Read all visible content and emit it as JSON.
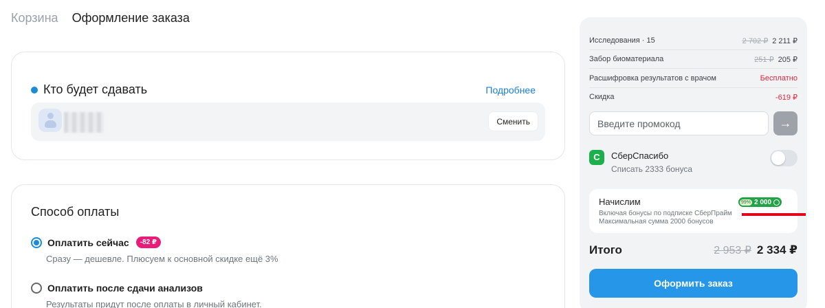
{
  "breadcrumb": {
    "prev": "Корзина",
    "current": "Оформление заказа"
  },
  "who": {
    "title": "Кто будет сдавать",
    "more_link": "Подробнее",
    "change_button": "Сменить"
  },
  "payment": {
    "title": "Способ оплаты",
    "options": [
      {
        "label": "Оплатить сейчас",
        "badge": "-82 ₽",
        "description": "Сразу — дешевле. Плюсуем к основной скидке ещё 3%",
        "selected": true
      },
      {
        "label": "Оплатить после сдачи анализов",
        "description": "Результаты придут после оплаты в личный кабинет.",
        "selected": false
      }
    ]
  },
  "summary": {
    "lines": [
      {
        "label": "Исследования · 15",
        "old": "2 702 ₽",
        "value": "2 211 ₽"
      },
      {
        "label": "Забор биоматериала",
        "old": "251 ₽",
        "value": "205 ₽"
      },
      {
        "label": "Расшифровка результатов с врачом",
        "value": "Бесплатно"
      },
      {
        "label": "Скидка",
        "value": "-619 ₽"
      }
    ],
    "promo_placeholder": "Введите промокод",
    "sber": {
      "logo": "С",
      "title": "СберСпасибо",
      "subtitle": "Списать 2333 бонуса",
      "enabled": false
    },
    "accrue": {
      "title": "Начислим",
      "line1": "Включая бонусы по подписке СберПрайм",
      "line2": "Максимальная сумма 2000 бонусов",
      "badge_percent": "99%",
      "badge_value": "2 000"
    },
    "total": {
      "label": "Итого",
      "old": "2 953 ₽",
      "value": "2 334 ₽"
    },
    "order_button": "Оформить заказ"
  },
  "colors": {
    "accent": "#2596e8",
    "sber_green": "#1bb04b",
    "discount_red": "#e1253c",
    "badge_pink": "#e81c79"
  }
}
